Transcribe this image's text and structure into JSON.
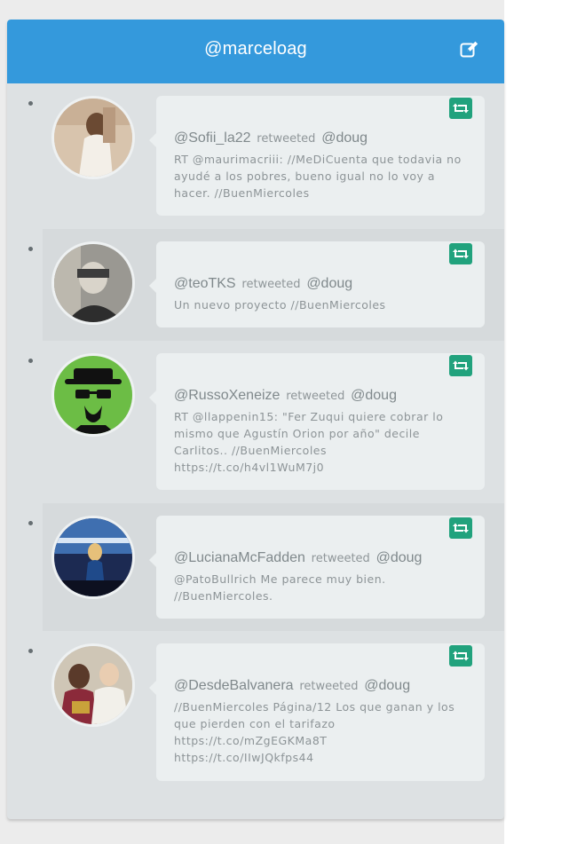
{
  "header": {
    "title": "@marceloag",
    "compose_icon": "compose-edit-icon",
    "background": "#3499dc"
  },
  "tweets": [
    {
      "user": "@Sofii_la22",
      "verb": "retweeted",
      "original": "@doug",
      "text": "RT @maurimacriii: //MeDiCuenta que todavia no ayudé a los pobres, bueno igual no lo voy a hacer. //BuenMiercoles",
      "retweet_icon": "retweet-icon"
    },
    {
      "user": "@teoTKS",
      "verb": "retweeted",
      "original": "@doug",
      "text": "Un nuevo proyecto //BuenMiercoles",
      "retweet_icon": "retweet-icon"
    },
    {
      "user": "@RussoXeneize",
      "verb": "retweeted",
      "original": "@doug",
      "text": "RT @llappenin15: \"Fer Zuqui quiere cobrar lo mismo que Agustín Orion por año\" decile Carlitos.. //BuenMiercoles\nhttps://t.co/h4vl1WuM7j0",
      "retweet_icon": "retweet-icon"
    },
    {
      "user": "@LucianaMcFadden",
      "verb": "retweeted",
      "original": "@doug",
      "text": "@PatoBullrich Me parece muy bien. //BuenMiercoles.",
      "retweet_icon": "retweet-icon"
    },
    {
      "user": "@DesdeBalvanera",
      "verb": "retweeted",
      "original": "@doug",
      "text": "//BuenMiercoles Página/12    Los que ganan y los que pierden con el tarifazo\nhttps://t.co/mZgEGKMa8T\nhttps://t.co/IIwJQkfps44",
      "retweet_icon": "retweet-icon"
    }
  ],
  "colors": {
    "retweet_button": "#21a27d",
    "card": "#ebeff0",
    "panel": "#dde1e3"
  }
}
